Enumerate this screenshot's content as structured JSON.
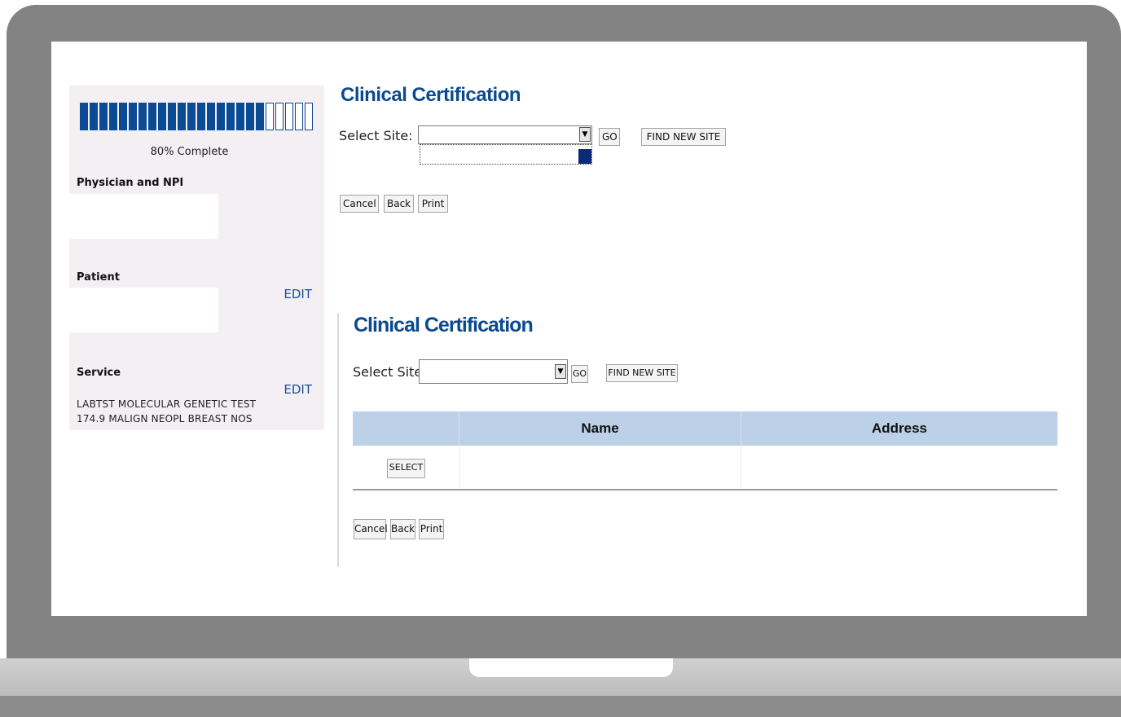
{
  "progress": {
    "complete_fraction": 0.8,
    "filled_segments": 19,
    "total_segments": 24,
    "label": "80% Complete",
    "color": "#0b4b95"
  },
  "sidebar": {
    "physician_title": "Physician and NPI",
    "patient_title": "Patient",
    "patient_edit": "EDIT",
    "service_title": "Service",
    "service_edit": "EDIT",
    "service_lines": [
      "LABTST MOLECULAR GENETIC TEST",
      "174.9 MALIGN NEOPL BREAST NOS"
    ]
  },
  "top_panel": {
    "title": "Clinical Certification",
    "select_label": "Select Site:",
    "select_value": "",
    "go_button": "GO",
    "find_button": "FIND NEW SITE",
    "cancel_button": "Cancel",
    "back_button": "Back",
    "print_button": "Print"
  },
  "bottom_panel": {
    "title": "Clinical Certification",
    "select_label": "Select Site:",
    "select_value": "",
    "go_button": "GO",
    "find_button": "FIND NEW SITE",
    "table": {
      "columns": [
        "",
        "Name",
        "Address"
      ],
      "rows": [
        {
          "select_button": "SELECT",
          "name": "",
          "address": ""
        }
      ]
    },
    "cancel_button": "Cancel",
    "back_button": "Back",
    "print_button": "Print"
  },
  "colors": {
    "title_blue": "#0b4a8f",
    "table_header": "#bcd0e7",
    "sidebar_bg": "#f3eff3",
    "laptop_frame": "#838383"
  }
}
